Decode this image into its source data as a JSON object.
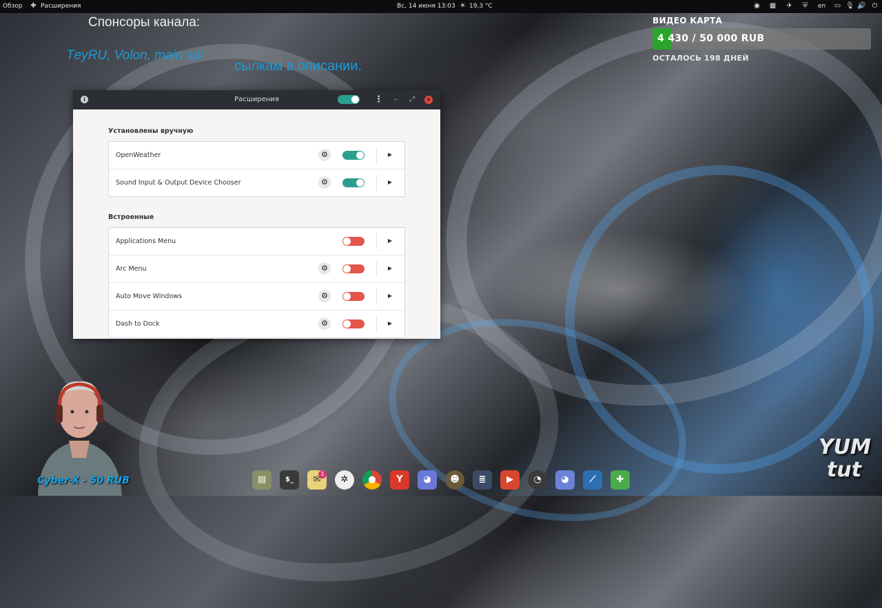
{
  "topbar": {
    "overview": "Обзор",
    "app_name": "Расширения",
    "datetime": "Вс, 14 июня  13:03",
    "weather": "19,3 °C",
    "language": "en"
  },
  "overlay": {
    "sponsors_text": "Спонсоры канала:",
    "sponsors_names": "ТeyRU, Volon, main spi",
    "links_text": "сылкам в описании.",
    "goal_title": "ВИДЕО КАРТА",
    "goal_amount": "4 430 / 50 000 RUB",
    "goal_progress": 0.0886,
    "goal_remaining": "ОСТАЛОСЬ 198 ДНЕЙ",
    "donor_label": "Cyber-X - 50 RUB",
    "logo_line1": "YUM",
    "logo_line2": "tut"
  },
  "window": {
    "title": "Расширения",
    "master_switch": "on",
    "sections": [
      {
        "title": "Установлены вручную",
        "items": [
          {
            "name": "OpenWeather",
            "has_settings": true,
            "enabled": true
          },
          {
            "name": "Sound Input & Output Device Chooser",
            "has_settings": true,
            "enabled": true
          }
        ]
      },
      {
        "title": "Встроенные",
        "items": [
          {
            "name": "Applications Menu",
            "has_settings": false,
            "enabled": false
          },
          {
            "name": "Arc Menu",
            "has_settings": true,
            "enabled": false
          },
          {
            "name": "Auto Move Windows",
            "has_settings": true,
            "enabled": false
          },
          {
            "name": "Dash to Dock",
            "has_settings": true,
            "enabled": false
          }
        ]
      }
    ]
  },
  "dock": {
    "apps": [
      "files-icon",
      "terminal-icon",
      "mail-icon",
      "video-player-icon",
      "chrome-icon",
      "yandex-browser-icon",
      "discord-icon",
      "gimp-icon",
      "code-editor-icon",
      "screen-recorder-icon",
      "obs-icon",
      "discord-alt-icon",
      "kdenlive-icon",
      "extensions-icon"
    ],
    "badge_count": "1"
  },
  "colors": {
    "switch_on": "#2b9e8f",
    "switch_off": "#e45649",
    "goal_fill": "#2aa52a",
    "titlebar": "#2b2e33",
    "accent_text": "#1a9bd7"
  }
}
